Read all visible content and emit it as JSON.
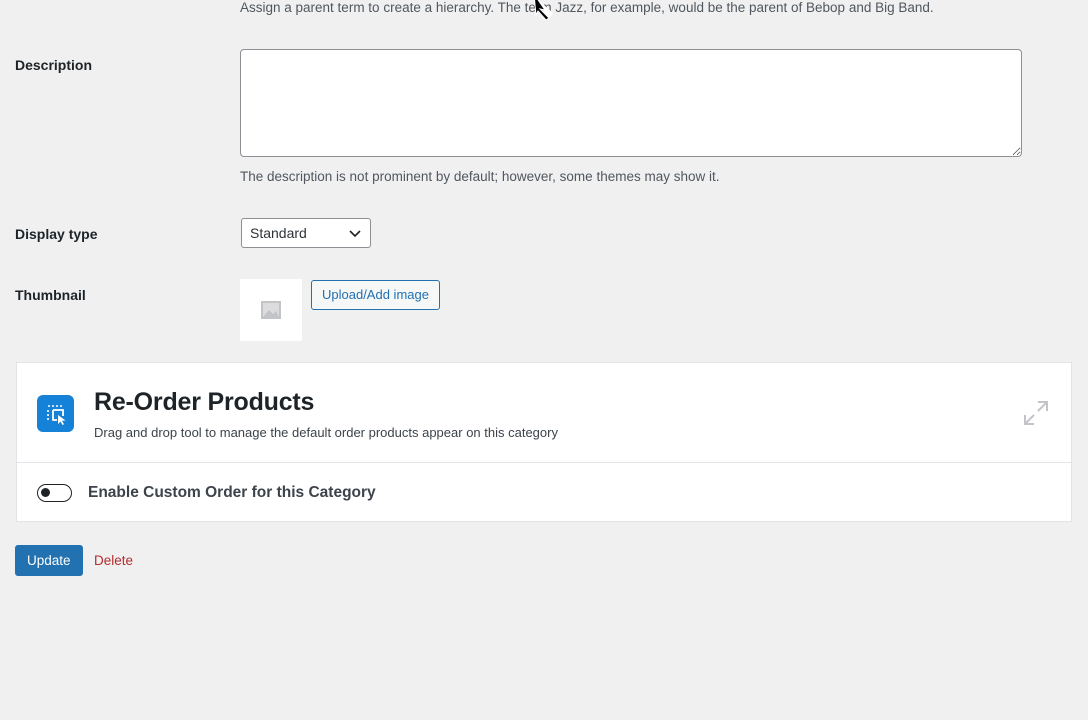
{
  "parent": {
    "help_text": "Assign a parent term to create a hierarchy. The term Jazz, for example, would be the parent of Bebop and Big Band."
  },
  "description": {
    "label": "Description",
    "value": "",
    "help_text": "The description is not prominent by default; however, some themes may show it."
  },
  "display_type": {
    "label": "Display type",
    "selected": "Standard"
  },
  "thumbnail": {
    "label": "Thumbnail",
    "upload_label": "Upload/Add image"
  },
  "reorder_panel": {
    "title": "Re-Order Products",
    "subtitle": "Drag and drop tool to manage the default order products appear on this category",
    "toggle_label": "Enable Custom Order for this Category",
    "toggle_on": false,
    "logo_icon": "reorder-logo-icon",
    "expand_icon": "expand-icon"
  },
  "actions": {
    "update_label": "Update",
    "delete_label": "Delete"
  },
  "colors": {
    "primary": "#2271b1",
    "danger": "#b32d2e",
    "logo": "#1582d8",
    "background": "#f0f0f1"
  }
}
